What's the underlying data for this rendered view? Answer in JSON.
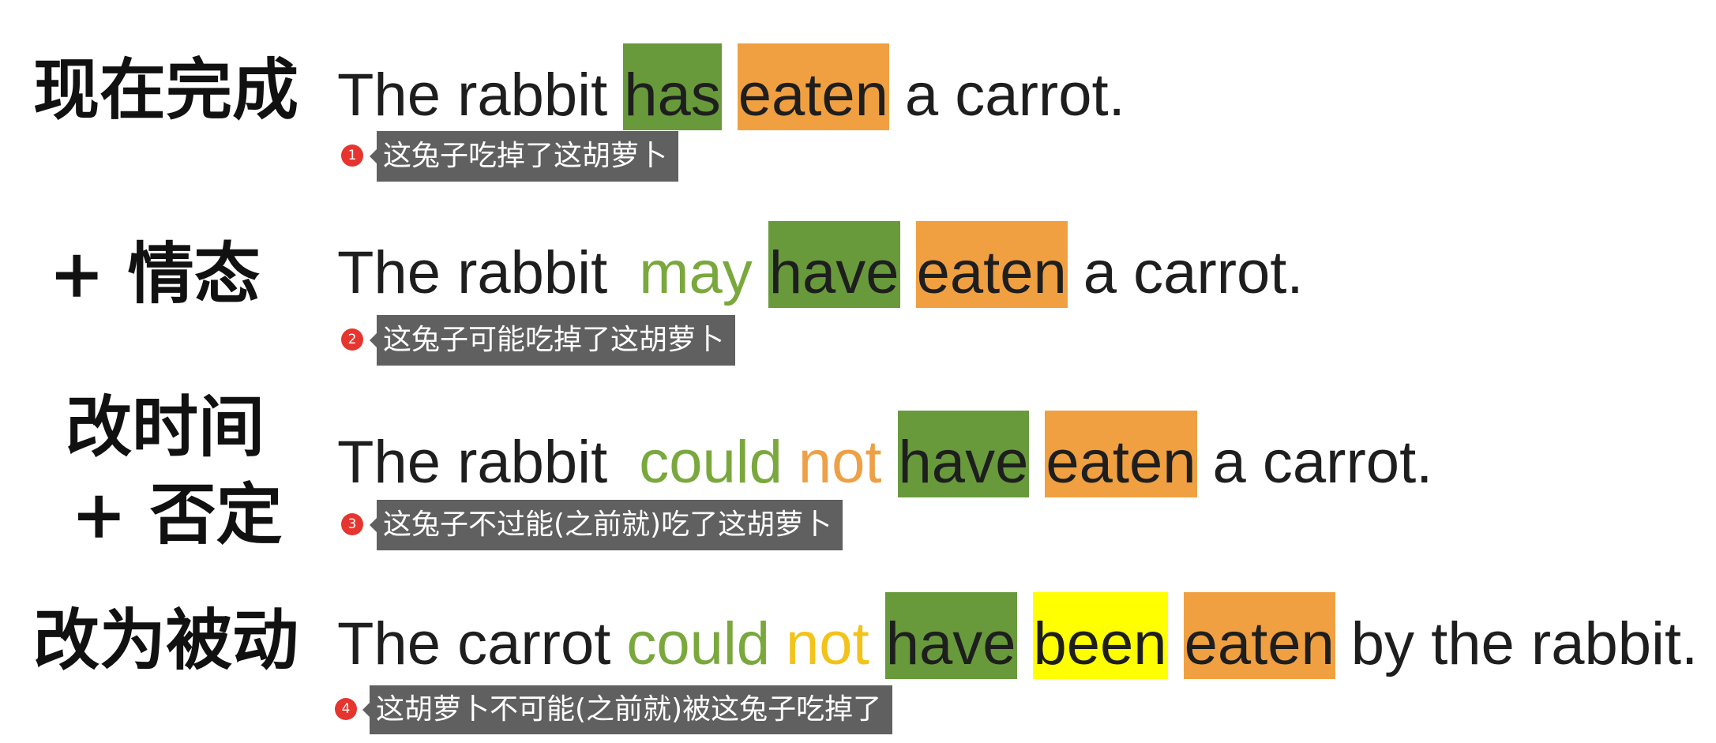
{
  "rows": [
    {
      "label_lines": [
        "现在完成"
      ],
      "sentence": [
        {
          "text": "The rabbit"
        },
        {
          "text": "has",
          "bg": "#689a3b"
        },
        {
          "text": "eaten",
          "bg": "#f0a040"
        },
        {
          "text": "a carrot."
        }
      ],
      "annotation": {
        "number": "1",
        "text": "这兔子吃掉了这胡萝卜"
      }
    },
    {
      "label_lines": [
        "+ 情态"
      ],
      "sentence": [
        {
          "text": "The rabbit"
        },
        {
          "text": "may",
          "fg": "#7aa83d"
        },
        {
          "text": "have",
          "bg": "#689a3b"
        },
        {
          "text": "eaten",
          "bg": "#f0a040"
        },
        {
          "text": "a carrot."
        }
      ],
      "annotation": {
        "number": "2",
        "text": "这兔子可能吃掉了这胡萝卜"
      }
    },
    {
      "label_lines": [
        "改时间",
        "+ 否定"
      ],
      "sentence": [
        {
          "text": "The rabbit"
        },
        {
          "text": "could",
          "fg": "#7aa83d"
        },
        {
          "text": "not",
          "fg": "#eea046"
        },
        {
          "text": "have",
          "bg": "#689a3b"
        },
        {
          "text": "eaten",
          "bg": "#f0a040"
        },
        {
          "text": "a carrot."
        }
      ],
      "annotation": {
        "number": "3",
        "text": "这兔子不过能(之前就)吃了这胡萝卜"
      }
    },
    {
      "label_lines": [
        "改为被动"
      ],
      "sentence": [
        {
          "text": "The carrot"
        },
        {
          "text": "could",
          "fg": "#7aa83d"
        },
        {
          "text": "not",
          "fg": "#f2c31a"
        },
        {
          "text": "have",
          "bg": "#689a3b"
        },
        {
          "text": "been",
          "bg": "#ffff00"
        },
        {
          "text": "eaten",
          "bg": "#f0a040"
        },
        {
          "text": "by the rabbit."
        }
      ],
      "annotation": {
        "number": "4",
        "text": "这胡萝卜不可能(之前就)被这兔子吃掉了"
      }
    }
  ],
  "colors": {
    "text": "#1e1e1e",
    "annotation_bg": "#606060",
    "badge": "#e6352f"
  }
}
